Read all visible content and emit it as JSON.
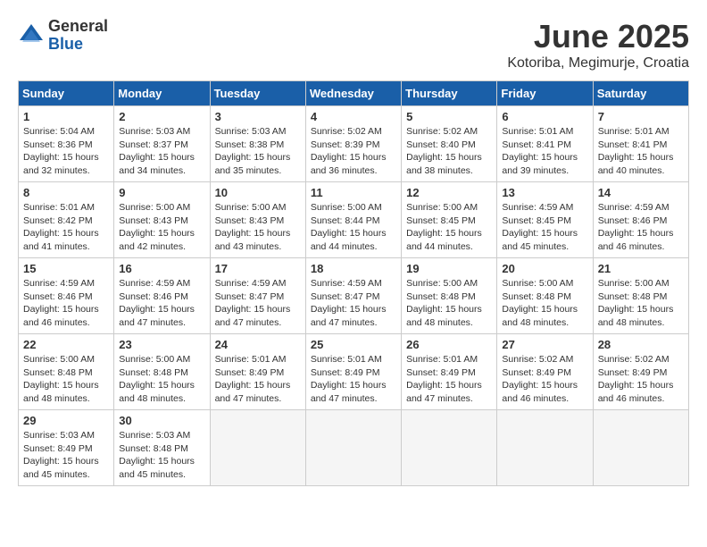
{
  "header": {
    "logo_general": "General",
    "logo_blue": "Blue",
    "title": "June 2025",
    "location": "Kotoriba, Megimurje, Croatia"
  },
  "calendar": {
    "headers": [
      "Sunday",
      "Monday",
      "Tuesday",
      "Wednesday",
      "Thursday",
      "Friday",
      "Saturday"
    ],
    "weeks": [
      [
        {
          "empty": true
        },
        {
          "empty": true
        },
        {
          "empty": true
        },
        {
          "empty": true
        },
        {
          "day": "5",
          "sunrise": "5:02 AM",
          "sunset": "8:40 PM",
          "daylight": "15 hours and 38 minutes."
        },
        {
          "day": "6",
          "sunrise": "5:01 AM",
          "sunset": "8:41 PM",
          "daylight": "15 hours and 39 minutes."
        },
        {
          "day": "7",
          "sunrise": "5:01 AM",
          "sunset": "8:41 PM",
          "daylight": "15 hours and 40 minutes."
        }
      ],
      [
        {
          "day": "1",
          "sunrise": "5:04 AM",
          "sunset": "8:36 PM",
          "daylight": "15 hours and 32 minutes."
        },
        {
          "day": "2",
          "sunrise": "5:03 AM",
          "sunset": "8:37 PM",
          "daylight": "15 hours and 34 minutes."
        },
        {
          "day": "3",
          "sunrise": "5:03 AM",
          "sunset": "8:38 PM",
          "daylight": "15 hours and 35 minutes."
        },
        {
          "day": "4",
          "sunrise": "5:02 AM",
          "sunset": "8:39 PM",
          "daylight": "15 hours and 36 minutes."
        },
        {
          "day": "5",
          "sunrise": "5:02 AM",
          "sunset": "8:40 PM",
          "daylight": "15 hours and 38 minutes."
        },
        {
          "day": "6",
          "sunrise": "5:01 AM",
          "sunset": "8:41 PM",
          "daylight": "15 hours and 39 minutes."
        },
        {
          "day": "7",
          "sunrise": "5:01 AM",
          "sunset": "8:41 PM",
          "daylight": "15 hours and 40 minutes."
        }
      ],
      [
        {
          "day": "8",
          "sunrise": "5:01 AM",
          "sunset": "8:42 PM",
          "daylight": "15 hours and 41 minutes."
        },
        {
          "day": "9",
          "sunrise": "5:00 AM",
          "sunset": "8:43 PM",
          "daylight": "15 hours and 42 minutes."
        },
        {
          "day": "10",
          "sunrise": "5:00 AM",
          "sunset": "8:43 PM",
          "daylight": "15 hours and 43 minutes."
        },
        {
          "day": "11",
          "sunrise": "5:00 AM",
          "sunset": "8:44 PM",
          "daylight": "15 hours and 44 minutes."
        },
        {
          "day": "12",
          "sunrise": "5:00 AM",
          "sunset": "8:45 PM",
          "daylight": "15 hours and 44 minutes."
        },
        {
          "day": "13",
          "sunrise": "4:59 AM",
          "sunset": "8:45 PM",
          "daylight": "15 hours and 45 minutes."
        },
        {
          "day": "14",
          "sunrise": "4:59 AM",
          "sunset": "8:46 PM",
          "daylight": "15 hours and 46 minutes."
        }
      ],
      [
        {
          "day": "15",
          "sunrise": "4:59 AM",
          "sunset": "8:46 PM",
          "daylight": "15 hours and 46 minutes."
        },
        {
          "day": "16",
          "sunrise": "4:59 AM",
          "sunset": "8:46 PM",
          "daylight": "15 hours and 47 minutes."
        },
        {
          "day": "17",
          "sunrise": "4:59 AM",
          "sunset": "8:47 PM",
          "daylight": "15 hours and 47 minutes."
        },
        {
          "day": "18",
          "sunrise": "4:59 AM",
          "sunset": "8:47 PM",
          "daylight": "15 hours and 47 minutes."
        },
        {
          "day": "19",
          "sunrise": "5:00 AM",
          "sunset": "8:48 PM",
          "daylight": "15 hours and 48 minutes."
        },
        {
          "day": "20",
          "sunrise": "5:00 AM",
          "sunset": "8:48 PM",
          "daylight": "15 hours and 48 minutes."
        },
        {
          "day": "21",
          "sunrise": "5:00 AM",
          "sunset": "8:48 PM",
          "daylight": "15 hours and 48 minutes."
        }
      ],
      [
        {
          "day": "22",
          "sunrise": "5:00 AM",
          "sunset": "8:48 PM",
          "daylight": "15 hours and 48 minutes."
        },
        {
          "day": "23",
          "sunrise": "5:00 AM",
          "sunset": "8:48 PM",
          "daylight": "15 hours and 48 minutes."
        },
        {
          "day": "24",
          "sunrise": "5:01 AM",
          "sunset": "8:49 PM",
          "daylight": "15 hours and 47 minutes."
        },
        {
          "day": "25",
          "sunrise": "5:01 AM",
          "sunset": "8:49 PM",
          "daylight": "15 hours and 47 minutes."
        },
        {
          "day": "26",
          "sunrise": "5:01 AM",
          "sunset": "8:49 PM",
          "daylight": "15 hours and 47 minutes."
        },
        {
          "day": "27",
          "sunrise": "5:02 AM",
          "sunset": "8:49 PM",
          "daylight": "15 hours and 46 minutes."
        },
        {
          "day": "28",
          "sunrise": "5:02 AM",
          "sunset": "8:49 PM",
          "daylight": "15 hours and 46 minutes."
        }
      ],
      [
        {
          "day": "29",
          "sunrise": "5:03 AM",
          "sunset": "8:49 PM",
          "daylight": "15 hours and 45 minutes."
        },
        {
          "day": "30",
          "sunrise": "5:03 AM",
          "sunset": "8:48 PM",
          "daylight": "15 hours and 45 minutes."
        },
        {
          "empty": true
        },
        {
          "empty": true
        },
        {
          "empty": true
        },
        {
          "empty": true
        },
        {
          "empty": true
        }
      ]
    ]
  }
}
